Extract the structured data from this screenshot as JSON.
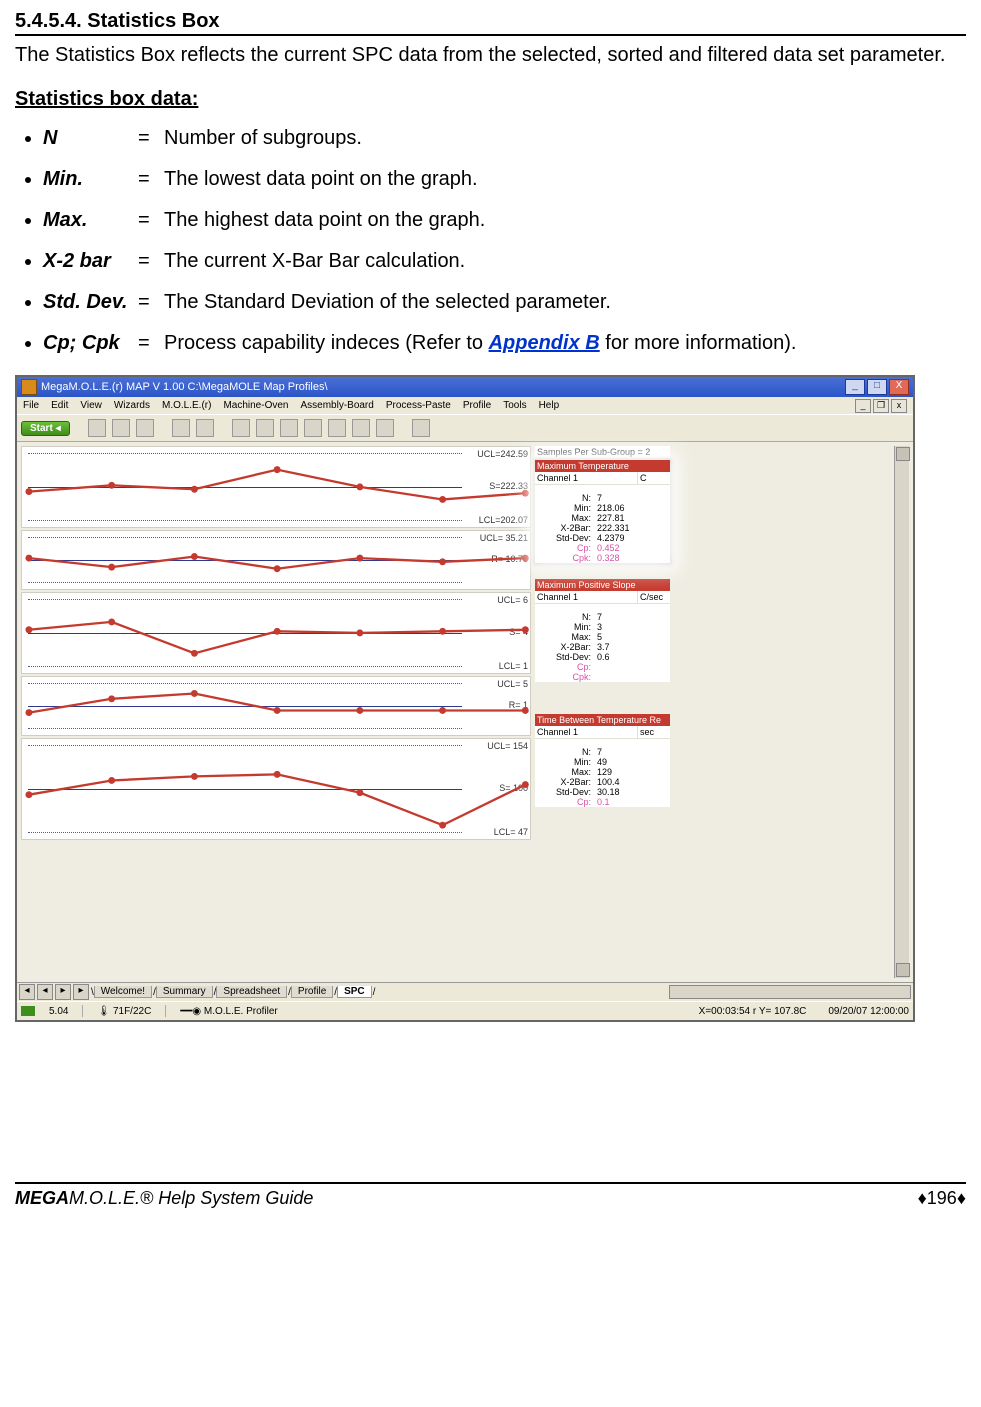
{
  "section": {
    "number": "5.4.5.4.",
    "title": "Statistics Box",
    "intro": "The Statistics Box reflects the current SPC data from the selected, sorted and filtered data set parameter.",
    "subhead": "Statistics box data:"
  },
  "defs": [
    {
      "label": "N",
      "desc": "Number of subgroups."
    },
    {
      "label": "Min.",
      "desc": "The lowest data point on the graph."
    },
    {
      "label": "Max.",
      "desc": "The highest data point on the graph."
    },
    {
      "label": "X-2 bar",
      "desc": "The current X-Bar Bar calculation."
    },
    {
      "label": "Std. Dev.",
      "desc": "The Standard Deviation of the selected parameter."
    }
  ],
  "cpcpk": {
    "label": "Cp; Cpk",
    "pre": "Process capability indeces (Refer to ",
    "link": "Appendix B",
    "post": " for more information)."
  },
  "shot": {
    "title": "MegaM.O.L.E.(r) MAP V 1.00    C:\\MegaMOLE Map Profiles\\",
    "menus": [
      "File",
      "Edit",
      "View",
      "Wizards",
      "M.O.L.E.(r)",
      "Machine-Oven",
      "Assembly-Board",
      "Process-Paste",
      "Profile",
      "Tools",
      "Help"
    ],
    "start": "Start",
    "tabs": [
      "Welcome!",
      "Summary",
      "Spreadsheet",
      "Profile",
      "SPC"
    ],
    "status": {
      "left1": "5.04",
      "left2": "71F/22C",
      "left3": "M.O.L.E. Profiler",
      "right1": "X=00:03:54 r Y= 107.8C",
      "right2": "09/20/07    12:00:00"
    },
    "charts": [
      {
        "labels": {
          "ucl": "UCL=242.59",
          "mid": "S=222.33",
          "lcl": "LCL=202.07"
        },
        "pts": [
          48,
          40,
          45,
          20,
          42,
          58,
          50
        ]
      },
      {
        "labels": {
          "ucl": "UCL= 35.21",
          "mid": "R= 10.78",
          "lcl": ""
        },
        "pts": [
          38,
          55,
          35,
          58,
          38,
          45,
          38
        ],
        "sm": true
      },
      {
        "labels": {
          "ucl": "UCL=   6",
          "mid": "S=   4",
          "lcl": "LCL=   1"
        },
        "pts": [
          38,
          28,
          68,
          40,
          42,
          40,
          38
        ]
      },
      {
        "labels": {
          "ucl": "UCL=   5",
          "mid": "R=   1",
          "lcl": ""
        },
        "pts": [
          54,
          28,
          18,
          50,
          50,
          50,
          50
        ],
        "sm": true
      },
      {
        "labels": {
          "ucl": "UCL=  154",
          "mid": "S=  100",
          "lcl": "LCL=   47"
        },
        "pts": [
          48,
          34,
          30,
          28,
          46,
          78,
          38
        ],
        "med": true
      }
    ],
    "samples_header": "Samples Per Sub-Group = 2",
    "boxes": [
      {
        "highlight": true,
        "redtitle": "Maximum Temperature",
        "channel": "Channel 1",
        "unit": "C",
        "rows": [
          {
            "k": "N:",
            "v": "7"
          },
          {
            "k": "Min:",
            "v": "218.06"
          },
          {
            "k": "Max:",
            "v": "227.81"
          },
          {
            "k": "X-2Bar:",
            "v": "222.331"
          },
          {
            "k": "Std-Dev:",
            "v": "4.2379"
          }
        ],
        "pinkrows": [
          {
            "k": "Cp:",
            "v": "0.452"
          },
          {
            "k": "Cpk:",
            "v": "0.328"
          }
        ]
      },
      {
        "redtitle": "Maximum Positive Slope",
        "channel": "Channel 1",
        "unit": "C/sec",
        "rows": [
          {
            "k": "N:",
            "v": "7"
          },
          {
            "k": "Min:",
            "v": "3"
          },
          {
            "k": "Max:",
            "v": "5"
          },
          {
            "k": "X-2Bar:",
            "v": "3.7"
          },
          {
            "k": "Std-Dev:",
            "v": "0.6"
          }
        ],
        "pinkrows": [
          {
            "k": "Cp:",
            "v": ""
          },
          {
            "k": "Cpk:",
            "v": ""
          }
        ]
      },
      {
        "redtitle": "Time Between Temperature Re",
        "channel": "Channel 1",
        "unit": "sec",
        "rows": [
          {
            "k": "N:",
            "v": "7"
          },
          {
            "k": "Min:",
            "v": "49"
          },
          {
            "k": "Max:",
            "v": "129"
          },
          {
            "k": "X-2Bar:",
            "v": "100.4"
          },
          {
            "k": "Std-Dev:",
            "v": "30.18"
          }
        ],
        "pinkrows": [
          {
            "k": "Cp:",
            "v": "0.1"
          }
        ]
      }
    ]
  },
  "footer": {
    "left_prefix": "MEGA",
    "left_rest": "M.O.L.E.® Help System Guide",
    "page": "196"
  }
}
